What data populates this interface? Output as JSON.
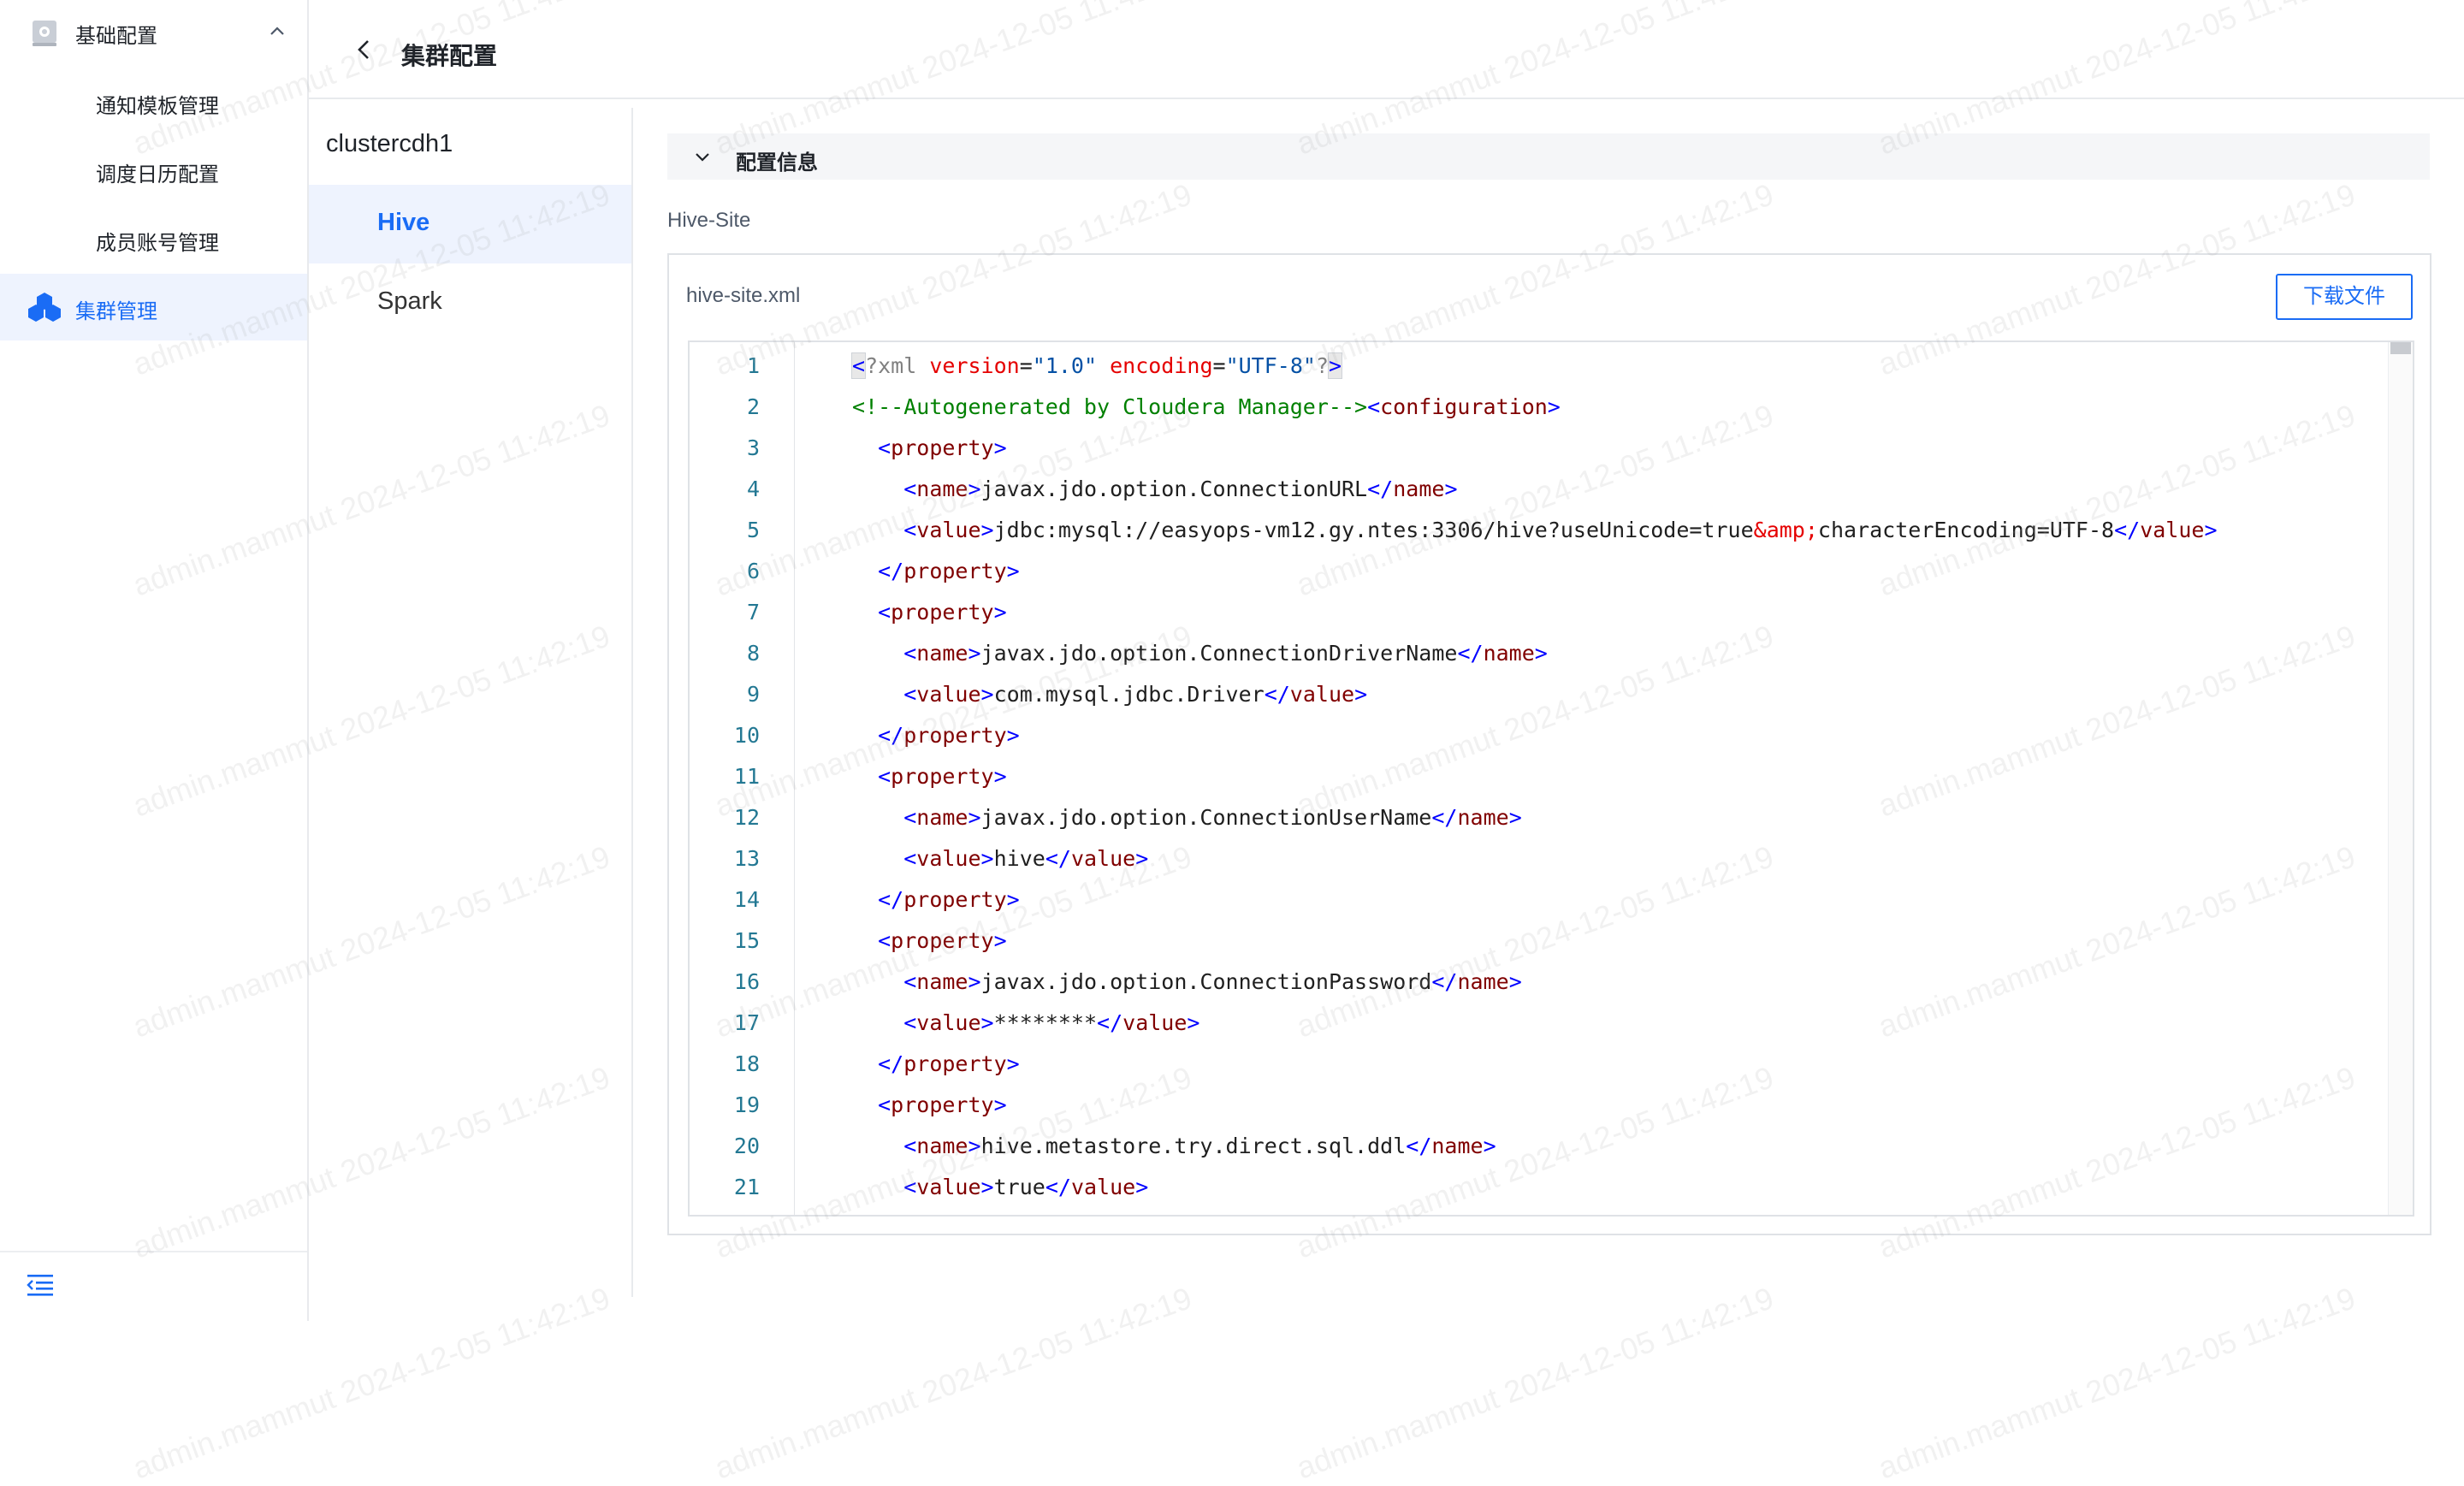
{
  "sidebar": {
    "group_label": "基础配置",
    "items": [
      {
        "label": "通知模板管理"
      },
      {
        "label": "调度日历配置"
      },
      {
        "label": "成员账号管理"
      }
    ],
    "active_label": "集群管理",
    "accent_color": "#1a6cf5"
  },
  "header": {
    "title": "集群配置"
  },
  "cluster": {
    "name": "clustercdh1",
    "services": [
      {
        "label": "Hive",
        "active": true
      },
      {
        "label": "Spark",
        "active": false
      }
    ]
  },
  "section": {
    "title": "配置信息",
    "site_label": "Hive-Site"
  },
  "file": {
    "name": "hive-site.xml",
    "download_label": "下载文件"
  },
  "code": {
    "lines": [
      "<?xml version=\"1.0\" encoding=\"UTF-8\"?>",
      "<!--Autogenerated by Cloudera Manager--><configuration>",
      "  <property>",
      "    <name>javax.jdo.option.ConnectionURL</name>",
      "    <value>jdbc:mysql://easyops-vm12.gy.ntes:3306/hive?useUnicode=true&amp;characterEncoding=UTF-8</value>",
      "  </property>",
      "  <property>",
      "    <name>javax.jdo.option.ConnectionDriverName</name>",
      "    <value>com.mysql.jdbc.Driver</value>",
      "  </property>",
      "  <property>",
      "    <name>javax.jdo.option.ConnectionUserName</name>",
      "    <value>hive</value>",
      "  </property>",
      "  <property>",
      "    <name>javax.jdo.option.ConnectionPassword</name>",
      "    <value>********</value>",
      "  </property>",
      "  <property>",
      "    <name>hive.metastore.try.direct.sql.ddl</name>",
      "    <value>true</value>"
    ]
  },
  "watermark": {
    "text": "admin.mammut 2024-12-05 11:42:19"
  }
}
